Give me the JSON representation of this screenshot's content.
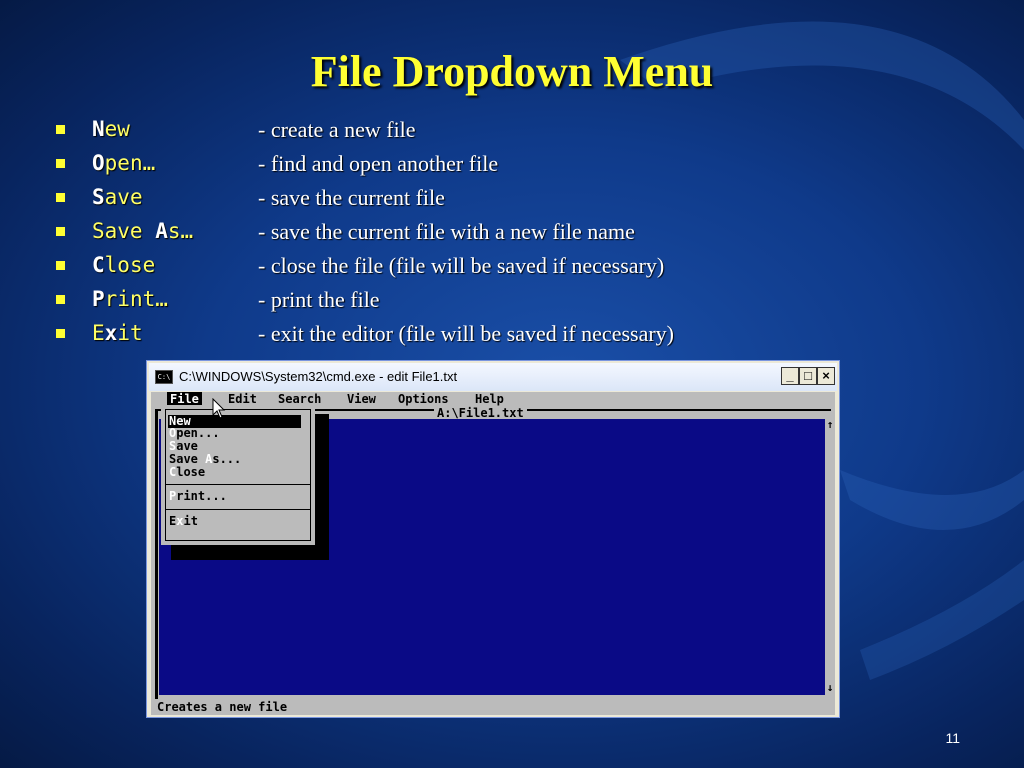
{
  "slide": {
    "title": "File Dropdown Menu",
    "page_number": "11",
    "bullets": [
      {
        "cmd_hot": "N",
        "cmd_rest": "ew",
        "cmd_pre": "",
        "desc": "- create a new file"
      },
      {
        "cmd_hot": "O",
        "cmd_rest": "pen…",
        "cmd_pre": "",
        "desc": "- find and open another file"
      },
      {
        "cmd_hot": "S",
        "cmd_rest": "ave",
        "cmd_pre": "",
        "desc": "- save the current file"
      },
      {
        "cmd_hot": "A",
        "cmd_rest": "s…",
        "cmd_pre": "Save ",
        "desc": "- save the current file with a new file name"
      },
      {
        "cmd_hot": "C",
        "cmd_rest": "lose",
        "cmd_pre": "",
        "desc": "- close the file (file will be saved if necessary)"
      },
      {
        "cmd_hot": "P",
        "cmd_rest": "rint…",
        "cmd_pre": "",
        "desc": "- print the file"
      },
      {
        "cmd_hot": "x",
        "cmd_rest": "it",
        "cmd_pre": "E",
        "desc": "- exit the editor (file will be saved if necessary)"
      }
    ],
    "bullet_color": "#ffff33"
  },
  "window": {
    "title": "C:\\WINDOWS\\System32\\cmd.exe - edit File1.txt",
    "icon_text": "C:\\",
    "minimize": "_",
    "maximize": "□",
    "close": "×"
  },
  "editor": {
    "menus": [
      "File",
      "Edit",
      "Search",
      "View",
      "Options",
      "Help"
    ],
    "active_menu": "File",
    "file_title": "A:\\File1.txt",
    "status": "Creates a new file",
    "scroll_up": "↑",
    "scroll_down": "↓",
    "edit_bg": "#0a0a86",
    "dropdown": {
      "group1": [
        {
          "hot": "N",
          "rest": "ew",
          "pre": ""
        },
        {
          "hot": "O",
          "rest": "pen...",
          "pre": ""
        },
        {
          "hot": "S",
          "rest": "ave",
          "pre": ""
        },
        {
          "hot": "A",
          "rest": "s...",
          "pre": "Save "
        },
        {
          "hot": "C",
          "rest": "lose",
          "pre": ""
        }
      ],
      "group2": [
        {
          "hot": "P",
          "rest": "rint...",
          "pre": ""
        }
      ],
      "group3": [
        {
          "hot": "x",
          "rest": "it",
          "pre": "E"
        }
      ],
      "selected": "New"
    }
  }
}
